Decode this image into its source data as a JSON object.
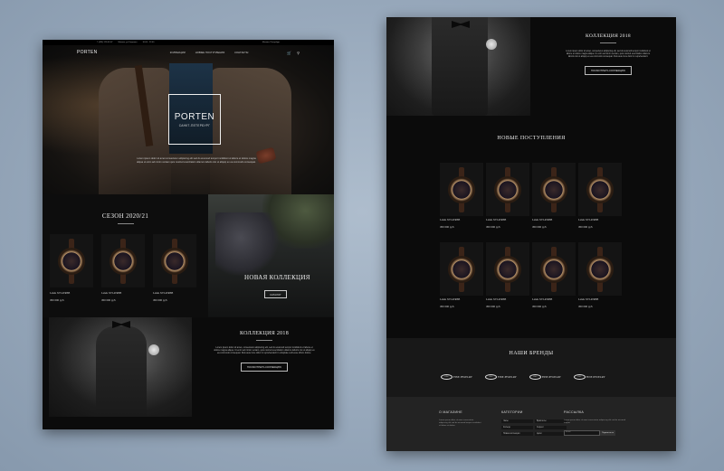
{
  "left": {
    "topbar": {
      "phone": "7 (495) 123-45-67",
      "address": "Москва, ул.Тверская",
      "hours": "10:00 - 22:00",
      "city": "Москва, Петербург"
    },
    "nav": {
      "logo": "PORTEN",
      "items": [
        "Коллекции",
        "Новые поступления",
        "Контакты"
      ],
      "cart_icon": "cart-icon",
      "search_icon": "search-icon"
    },
    "hero": {
      "title": "PORTEN",
      "subtitle": "САНКТ-ПЕТЕРБУРГ",
      "text": "Lorem ipsum dolor sit amet consectetur adipiscing elit sed do eiusmod tempor incididunt ut labore et dolore magna aliqua ut enim ad minim veniam quis nostrud exercitation ullamco laboris nisi ut aliquip ex ea commodo consequat."
    },
    "season": {
      "title": "СЕЗОН 2020/21",
      "products": [
        {
          "name": "Lando XVI ATREB",
          "price": "450 000 руб."
        },
        {
          "name": "Lando XVI ATREB",
          "price": "450 000 руб."
        },
        {
          "name": "Lando XVI ATREB",
          "price": "450 000 руб."
        }
      ]
    },
    "new_collection": {
      "title": "НОВАЯ КОЛЛЕКЦИЯ",
      "button": "КАТАЛОГ"
    },
    "collection": {
      "title": "КОЛЛЕКЦИЯ 2018",
      "text": "Lorem ipsum dolor sit amet, consectetur adipiscing elit, sed do eiusmod tempor incididunt ut labore et dolore magna aliqua. Ut enim ad minim veniam, quis nostrud exercitation ullamco laboris nisi ut aliquip ex ea commodo consequat. Duis aute irure dolor in reprehenderit in voluptate velit esse cillum dolore.",
      "button": "ПОСМОТРЕТЬ КОЛЛЕКЦИЮ"
    }
  },
  "right": {
    "collection": {
      "title": "КОЛЛЕКЦИЯ 2018",
      "text": "Lorem ipsum dolor sit amet, consectetur adipiscing elit, sed do eiusmod tempor incididunt ut labore et dolore magna aliqua. Ut enim ad minim veniam, quis nostrud exercitation ullamco laboris nisi ut aliquip ex ea commodo consequat. Duis aute irure dolor in reprehenderit.",
      "button": "ПОСМОТРЕТЬ КОЛЛЕКЦИЮ"
    },
    "arrivals": {
      "title": "НОВЫЕ ПОСТУПЛЕНИЯ",
      "products": [
        {
          "name": "Lando XVI ATREB",
          "price": "450 000 руб."
        },
        {
          "name": "Lando XVI ATREB",
          "price": "450 000 руб."
        },
        {
          "name": "Lando XVI ATREB",
          "price": "450 000 руб."
        },
        {
          "name": "Lando XVI ATREB",
          "price": "450 000 руб."
        },
        {
          "name": "Lando XVI ATREB",
          "price": "450 000 руб."
        },
        {
          "name": "Lando XVI ATREB",
          "price": "450 000 руб."
        },
        {
          "name": "Lando XVI ATREB",
          "price": "450 000 руб."
        },
        {
          "name": "Lando XVI ATREB",
          "price": "450 000 руб."
        }
      ]
    },
    "brands": {
      "title": "НАШИ БРЕНДЫ",
      "items": [
        {
          "mark": "CGC",
          "name": "FINE JEWELRY"
        },
        {
          "mark": "CGC",
          "name": "FINE JEWELRY"
        },
        {
          "mark": "CGC",
          "name": "FINE JEWELRY"
        },
        {
          "mark": "CGC",
          "name": "FINE JEWELRY"
        }
      ]
    },
    "footer": {
      "about_title": "О МАГАЗИНЕ",
      "about_text": "Lorem ipsum dolor sit amet consectetur adipiscing elit sed do eiusmod tempor incididunt ut labore et dolore.",
      "categories_title": "КАТЕГОРИИ",
      "categories": [
        "Часы",
        "Браслеты",
        "Кольца",
        "Серьги",
        "Новая коллекция",
        "Цепи"
      ],
      "newsletter_title": "РАССЫЛКА",
      "newsletter_text": "Lorem ipsum dolor sit amet consectetur adipiscing elit sed do eiusmod tempor.",
      "email_placeholder": "Email",
      "subscribe_button": "Подписаться"
    }
  },
  "colors": {
    "background": "#97a8bb",
    "board": "#0b0b0b",
    "text": "#eeeeee"
  }
}
